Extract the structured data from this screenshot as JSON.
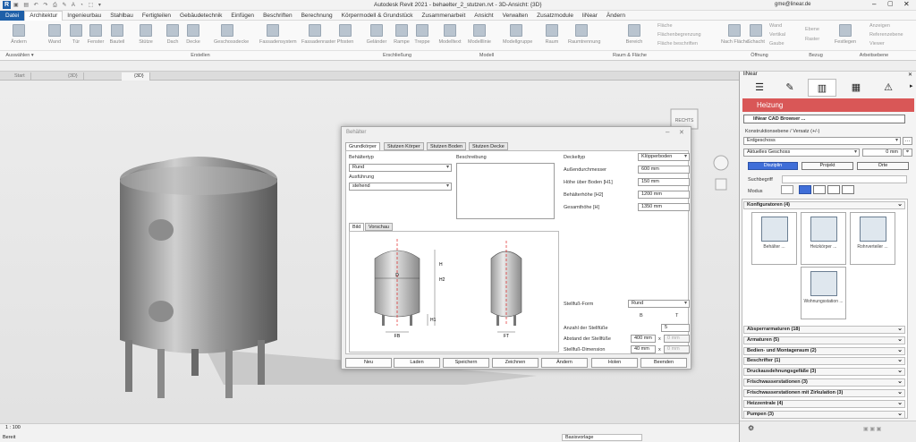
{
  "window": {
    "title": "Autodesk Revit 2021 - behaelter_2_stutzen.rvt - 3D-Ansicht: {3D}",
    "user": "gme@linear.de"
  },
  "menu": [
    "Datei",
    "Architektur",
    "Ingenieurbau",
    "Stahlbau",
    "Fertigteilen",
    "Gebäudetechnik",
    "Einfügen",
    "Beschriften",
    "Berechnung",
    "Körpermodell & Grundstück",
    "Zusammenarbeit",
    "Ansicht",
    "Verwalten",
    "Zusatzmodule",
    "liNear",
    "Ändern"
  ],
  "ribbon": {
    "build": [
      "Ändern",
      "Wand",
      "Tür",
      "Fenster",
      "Bauteil",
      "Stütze",
      "Dach",
      "Decke",
      "Geschossdecke",
      "Fassadensystem",
      "Fassadenraster",
      "Pfosten"
    ],
    "circ": [
      "Geländer",
      "Rampe",
      "Treppe"
    ],
    "model": [
      "Modelltext",
      "Modelllinie",
      "Modellgruppe"
    ],
    "room": [
      "Raum",
      "Raumtrennung",
      "Bereich"
    ],
    "small": [
      "Fläche",
      "Flächenbegrenzung",
      "Fläche beschriften",
      "Nach Fläche",
      "Schacht",
      "Wand",
      "Vertikal",
      "Gaube",
      "Ebene",
      "Raster",
      "Anzeigen",
      "Referenzebene",
      "Viewer",
      "Festlegen"
    ],
    "groups": [
      "Auswählen ▾",
      "Erstellen",
      "Erschließung",
      "Modell",
      "Raum & Fläche",
      "Öffnung",
      "Bezug",
      "Arbeitsebene"
    ]
  },
  "view_tabs": [
    "Start",
    "{3D}",
    "{3D}"
  ],
  "status": {
    "scale": "1 : 100",
    "left": "Bereit",
    "workset": "Basisvorlage"
  },
  "dialog": {
    "title": "Behälter",
    "tabs": [
      "Grundkörper",
      "Stutzen Körper",
      "Stutzen Boden",
      "Stutzen Decke"
    ],
    "behaeltertyp_label": "Behältertyp",
    "behaeltertyp": "Rund",
    "ausfuehrung_label": "Ausführung",
    "ausfuehrung": "stehend",
    "beschreibung_label": "Beschreibung",
    "deckeltyp_label": "Deckeltyp",
    "deckeltyp": "Klöpperboden",
    "rows": [
      {
        "label": "Außendurchmesser",
        "value": "600 mm"
      },
      {
        "label": "Höhe über Boden [H1]",
        "value": "150 mm"
      },
      {
        "label": "Behälterhöhe [H2]",
        "value": "1200 mm"
      },
      {
        "label": "Gesamthöhe [H]",
        "value": "1350 mm"
      }
    ],
    "image_tabs": [
      "Bild",
      "Vorschau"
    ],
    "dim_labels": {
      "h": "H",
      "h1": "H1",
      "h2": "H2",
      "d": "D",
      "fb": "FB",
      "ft": "FT"
    },
    "stellfuss_form_label": "Stellfuß-Form",
    "stellfuss_form": "Rund",
    "col_b": "B",
    "col_t": "T",
    "anzahl_label": "Anzahl der Stellfüße",
    "anzahl": "5",
    "abstand_label": "Abstand der Stellfüße",
    "abstand": "400 mm",
    "abstand_t": "0 mm",
    "dimension_label": "Stellfuß-Dimension",
    "dimension": "40 mm",
    "dimension_t": "0 mm",
    "x": "x",
    "buttons": [
      "Neu",
      "Laden",
      "Speichern",
      "Zeichnen",
      "Ändern",
      "Holen",
      "Beenden"
    ]
  },
  "panel": {
    "title": "liNear",
    "heading": "Heizung",
    "cad_browser": "liNear CAD Browser ...",
    "ebene_label": "Konstruktionsebene / Versatz (+/-)",
    "ebene": "Erdgeschoss",
    "geschoss": "Aktuelles Geschoss",
    "offset": "0 mm",
    "disciplines": [
      "Disziplin",
      "Projekt",
      "Orte"
    ],
    "search_label": "Suchbegriff",
    "mode_label": "Modus",
    "konfiguratoren": "Konfiguratoren (4)",
    "cards": [
      "Behälter ...",
      "Heizkörper ...",
      "Rohrverteiler ...",
      "Wohnungsstation ..."
    ],
    "categories": [
      "Absperrarmaturen (18)",
      "Armaturen (5)",
      "Bedien- und Montageraum (2)",
      "Beschrifter (1)",
      "Druckausdehnungsgefäße (3)",
      "Frischwasserstationen (3)",
      "Frischwasserstationen mit Zirkulation (3)",
      "Heizzentrale (4)",
      "Pumpen (3)"
    ]
  },
  "viewcube": "RECHTS"
}
